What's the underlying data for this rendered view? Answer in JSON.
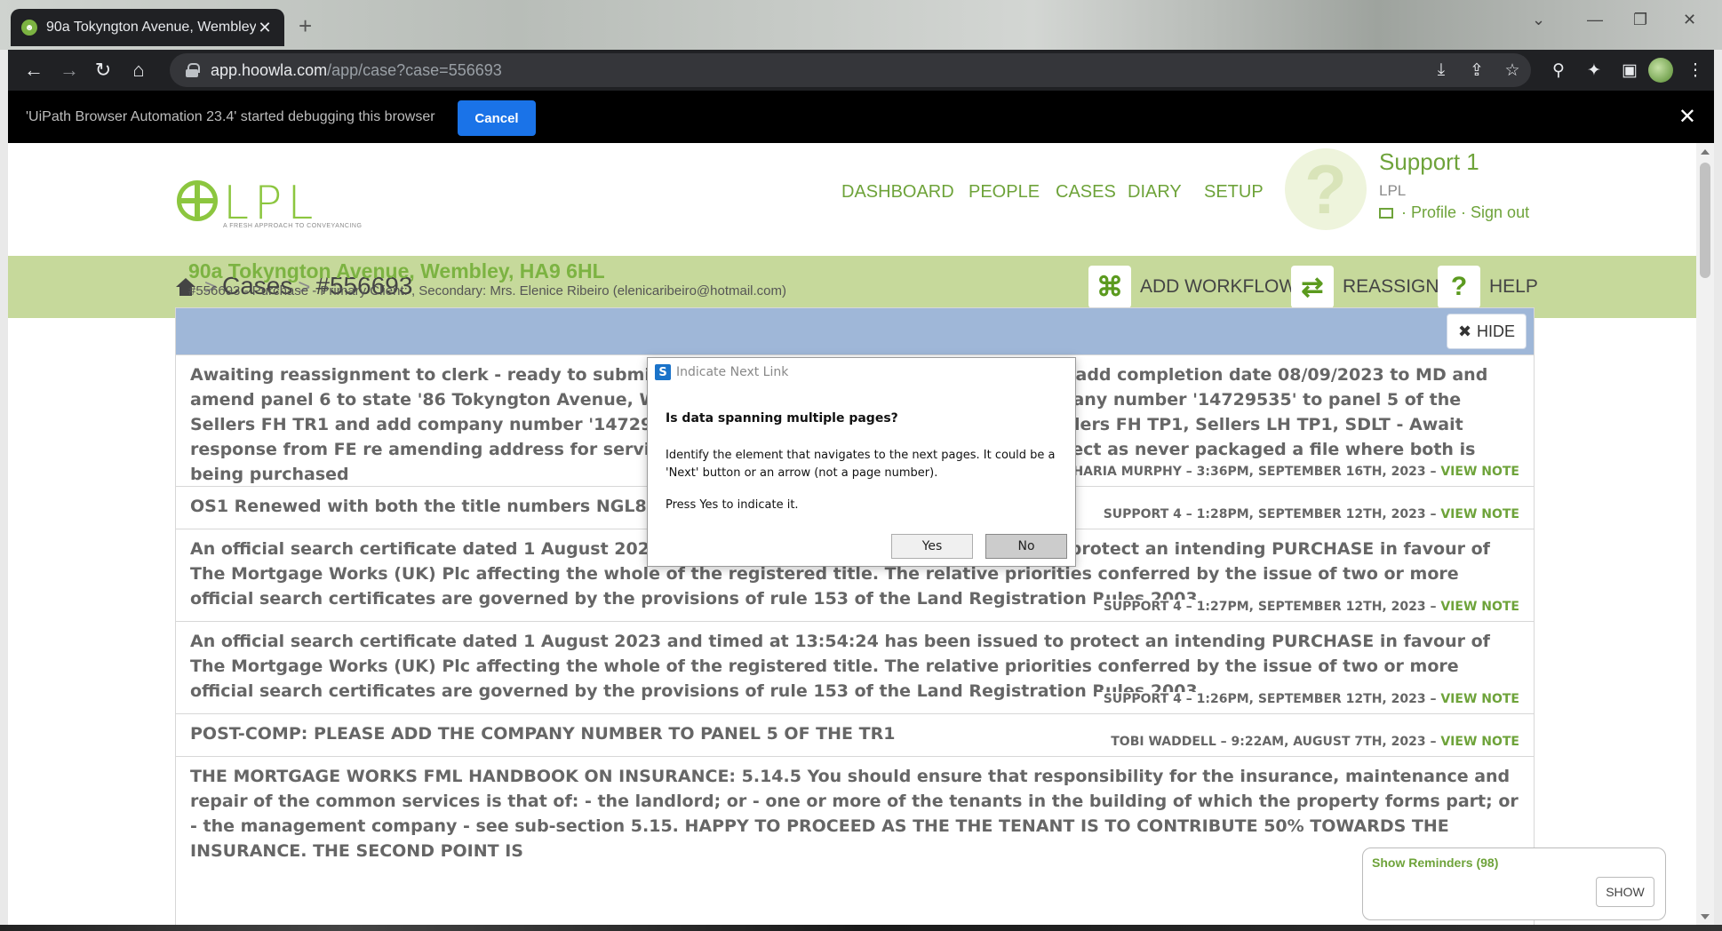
{
  "browser": {
    "tab_title": "90a Tokyngton Avenue, Wembley",
    "url_host": "app.hoowla.com",
    "url_path": "/app/case?case=556693"
  },
  "debugbar": {
    "message": "'UiPath Browser Automation 23.4' started debugging this browser",
    "cancel_label": "Cancel"
  },
  "site": {
    "logo_text": "LPL",
    "logo_tagline": "A FRESH APPROACH TO CONVEYANCING",
    "nav": [
      "DASHBOARD",
      "PEOPLE",
      "CASES",
      "DIARY",
      "SETUP"
    ],
    "user": {
      "name": "Support 1",
      "org": "LPL",
      "profile": "Profile",
      "signout": "Sign out"
    }
  },
  "breadcrumb": {
    "cases": "Cases",
    "case_id": "#556693"
  },
  "actions": {
    "add_workflow": "ADD WORKFLOW",
    "reassign": "REASSIGN",
    "help": "HELP"
  },
  "case": {
    "address": "90a Tokyngton Avenue, Wembley, HA9 6HL",
    "subtitle": "#556693 - Purchase - Primary Client: , Secondary: Mrs. Elenice Ribeiro (elenicaribeiro@hotmail.com)"
  },
  "notes_panel": {
    "hide_label": "HIDE"
  },
  "notes": [
    {
      "text": "Awaiting reassignment to clerk - ready to submit - PLEASE ADD COMPANY NUMBERS: TR1 to add completion date 08/09/2023 to MD and amend panel 6 to state '86 Tokyngton Avenue, Wembley, Middlesex, HA9 6HL' and add company number '14729535' to panel 5 of the Sellers FH TR1 and add company number '14729535' to Sellers LH TR1 - then submit MD, Sellers FH TP1, Sellers LH TP1, SDLT - Await response from FE re amending address for service in panel 6 - please make sure note is correct as never packaged a file where both is being purchased",
      "author": "SHARIA MURPHY – 3:36PM, SEPTEMBER 16TH, 2023 –",
      "link": "VIEW NOTE"
    },
    {
      "text": "OS1 Renewed with both the title numbers NGL841589 and NGL397291",
      "author": "SUPPORT 4 – 1:28PM, SEPTEMBER 12TH, 2023 –",
      "link": "VIEW NOTE"
    },
    {
      "text": "An official search certificate dated 1 August 2023 and timed at 13:55:08 has been issued to protect an intending PURCHASE in favour of The Mortgage Works (UK) Plc affecting the whole of the registered title. The relative priorities conferred by the issue of two or more official search certificates are governed by the provisions of rule 153 of the Land Registration Rules 2003.",
      "author": "SUPPORT 4 – 1:27PM, SEPTEMBER 12TH, 2023 –",
      "link": "VIEW NOTE"
    },
    {
      "text": "An official search certificate dated 1 August 2023 and timed at 13:54:24 has been issued to protect an intending PURCHASE in favour of The Mortgage Works (UK) Plc affecting the whole of the registered title. The relative priorities conferred by the issue of two or more official search certificates are governed by the provisions of rule 153 of the Land Registration Rules 2003.",
      "author": "SUPPORT 4 – 1:26PM, SEPTEMBER 12TH, 2023 –",
      "link": "VIEW NOTE"
    },
    {
      "text": "POST-COMP: PLEASE ADD THE COMPANY NUMBER TO PANEL 5 OF THE TR1",
      "author": "TOBI WADDELL – 9:22AM, AUGUST 7TH, 2023 –",
      "link": "VIEW NOTE"
    },
    {
      "text": "THE MORTGAGE WORKS FML HANDBOOK ON INSURANCE: 5.14.5 You should ensure that responsibility for the insurance, maintenance and repair of the common services is that of: - the landlord; or - one or more of the tenants in the building of which the property forms part; or - the management company - see sub-section 5.15. HAPPY TO PROCEED AS THE THE TENANT IS TO CONTRIBUTE 50% TOWARDS THE INSURANCE. THE SECOND POINT IS",
      "author": "",
      "link": ""
    }
  ],
  "reminders": {
    "label": "Show Reminders (98)",
    "show": "SHOW"
  },
  "dialog": {
    "title": "Indicate Next Link",
    "question": "Is data spanning multiple pages?",
    "description": "Identify the element that navigates to the next pages. It could be a 'Next' button or an arrow (not a page number).",
    "press": "Press Yes to indicate it.",
    "yes": "Yes",
    "no": "No"
  }
}
